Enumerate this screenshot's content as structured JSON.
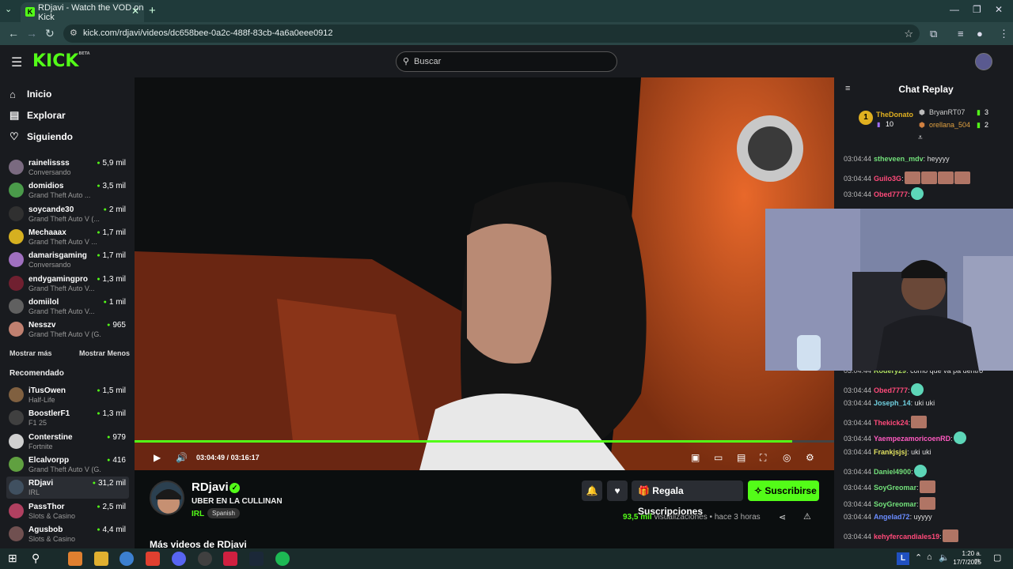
{
  "browser": {
    "tab_title": "RDjavi - Watch the VOD on Kick",
    "url": "kick.com/rdjavi/videos/dc658bee-0a2c-488f-83cb-4a6a0eee0912"
  },
  "header": {
    "logo": "KICK",
    "logo_badge": "BETA",
    "search_placeholder": "Buscar"
  },
  "sidebar": {
    "nav": [
      {
        "label": "Inicio",
        "icon": "home-icon"
      },
      {
        "label": "Explorar",
        "icon": "explore-icon"
      },
      {
        "label": "Siguiendo",
        "icon": "heart-icon"
      }
    ],
    "following": [
      {
        "name": "rainelissss",
        "category": "Conversando",
        "viewers": "5,9 mil",
        "color": "#7a6a80"
      },
      {
        "name": "domidios",
        "category": "Grand Theft Auto ...",
        "viewers": "3,5 mil",
        "color": "#4a9a4a"
      },
      {
        "name": "soycande30",
        "category": "Grand Theft Auto V (...",
        "viewers": "2 mil",
        "color": "#303030"
      },
      {
        "name": "Mechaaax",
        "category": "Grand Theft Auto V ...",
        "viewers": "1,7 mil",
        "color": "#d6b020"
      },
      {
        "name": "damarisgaming",
        "category": "Conversando",
        "viewers": "1,7 mil",
        "color": "#a070c0"
      },
      {
        "name": "endygamingpro",
        "category": "Grand Theft Auto V...",
        "viewers": "1,3 mil",
        "color": "#702030"
      },
      {
        "name": "domiilol",
        "category": "Grand Theft Auto V...",
        "viewers": "1 mil",
        "color": "#606060"
      },
      {
        "name": "Nesszv",
        "category": "Grand Theft Auto V (G...",
        "viewers": "965",
        "color": "#c08070"
      }
    ],
    "show_more": "Mostrar más",
    "show_less": "Mostrar Menos",
    "recommended_title": "Recomendado",
    "recommended": [
      {
        "name": "iTusOwen",
        "category": "Half-Life",
        "viewers": "1,5 mil",
        "color": "#806040"
      },
      {
        "name": "BoostlerF1",
        "category": "F1 25",
        "viewers": "1,3 mil",
        "color": "#404040"
      },
      {
        "name": "Conterstine",
        "category": "Fortnite",
        "viewers": "979",
        "color": "#d0d0d0"
      },
      {
        "name": "Elcalvorpp",
        "category": "Grand Theft Auto V (G...",
        "viewers": "416",
        "color": "#60a040"
      },
      {
        "name": "RDjavi",
        "category": "IRL",
        "viewers": "31,2 mil",
        "color": "#405060"
      },
      {
        "name": "PassThor",
        "category": "Slots & Casino",
        "viewers": "2,5 mil",
        "color": "#b04060"
      },
      {
        "name": "Agusbob",
        "category": "Slots & Casino",
        "viewers": "4,4 mil",
        "color": "#705050"
      }
    ]
  },
  "player": {
    "current_time": "03:04:49",
    "separator": "/",
    "duration": "03:16:17",
    "progress": 0.94
  },
  "channel": {
    "name": "RDjavi",
    "video_title": "UBER EN LA CULLINAN",
    "category": "IRL",
    "language": "Spanish",
    "gift_button": "Regala Suscripciones",
    "subscribe_button": "Suscribirse",
    "views_count": "93,5 mil",
    "views_label": "visualizaciones",
    "dot": "•",
    "time_ago": "hace 3 horas",
    "more_videos": "Más videos de RDjavi"
  },
  "chat": {
    "title": "Chat Replay",
    "leaderboard": [
      {
        "rank": "1",
        "name": "TheDonato",
        "count": "10"
      },
      {
        "name": "BryanRT07",
        "count": "3"
      },
      {
        "name": "orellana_504",
        "count": "2"
      }
    ],
    "messages_top": [
      {
        "time": "03:04:44",
        "user": "stheveen_mdv",
        "color": "#72e07a",
        "text": ": heyyyy",
        "emotes": 0
      },
      {
        "time": "03:04:44",
        "user": "Guilo3G",
        "color": "#ff4a7a",
        "text": ":",
        "emotes": 4
      },
      {
        "time": "03:04:44",
        "user": "Obed7777",
        "color": "#ff4a7a",
        "text": ":",
        "emotes": 1,
        "green": true
      }
    ],
    "messages_bottom": [
      {
        "time": "03:04:44",
        "user": "Rodery29",
        "color": "#b0e060",
        "text": ": como que va pa dentro",
        "emotes": 0
      },
      {
        "time": "03:04:44",
        "user": "Obed7777",
        "color": "#ff4a7a",
        "text": ":",
        "emotes": 1,
        "green": true
      },
      {
        "time": "03:04:44",
        "user": "Joseph_14",
        "color": "#70d0e0",
        "text": ": uki uki",
        "emotes": 0
      },
      {
        "time": "03:04:44",
        "user": "Thekick24",
        "color": "#ff4a7a",
        "text": ":",
        "emotes": 1
      },
      {
        "time": "03:04:44",
        "user": "YaempezamoricoenRD",
        "color": "#ff5ac0",
        "text": ":",
        "emotes": 1,
        "green": true
      },
      {
        "time": "03:04:44",
        "user": "Frankjsjsj",
        "color": "#e0e060",
        "text": ": uki uki",
        "emotes": 0
      },
      {
        "time": "03:04:44",
        "user": "Daniel4900",
        "color": "#72e07a",
        "text": ":",
        "emotes": 1,
        "green": true
      },
      {
        "time": "03:04:44",
        "user": "SoyGreomar",
        "color": "#72e07a",
        "text": ":",
        "emotes": 1
      },
      {
        "time": "03:04:44",
        "user": "SoyGreomar",
        "color": "#72e07a",
        "text": ":",
        "emotes": 1
      },
      {
        "time": "03:04:44",
        "user": "Angelad72",
        "color": "#6a8cff",
        "text": ": uyyyy",
        "emotes": 0
      },
      {
        "time": "03:04:44",
        "user": "kehyfercandiales19",
        "color": "#ff4a7a",
        "text": ":",
        "emotes": 1
      }
    ]
  },
  "taskbar": {
    "time": "1:20 a. m.",
    "date": "17/7/2025",
    "lang": "L"
  }
}
